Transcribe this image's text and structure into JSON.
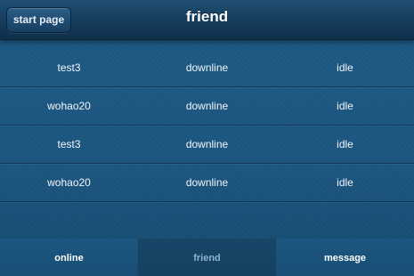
{
  "header": {
    "back_label": "start page",
    "title": "friend"
  },
  "friends": [
    {
      "name": "test3",
      "status": "downline",
      "state": "idle"
    },
    {
      "name": "wohao20",
      "status": "downline",
      "state": "idle"
    },
    {
      "name": "test3",
      "status": "downline",
      "state": "idle"
    },
    {
      "name": "wohao20",
      "status": "downline",
      "state": "idle"
    }
  ],
  "tabs": [
    {
      "label": "online",
      "selected": false
    },
    {
      "label": "friend",
      "selected": true
    },
    {
      "label": "message",
      "selected": false
    }
  ],
  "colors": {
    "background": "#1e5880",
    "navbar": "#173f5f",
    "selected_tab": "#164463",
    "selected_tab_text": "#8fb2cd",
    "text": "#ffffff"
  }
}
